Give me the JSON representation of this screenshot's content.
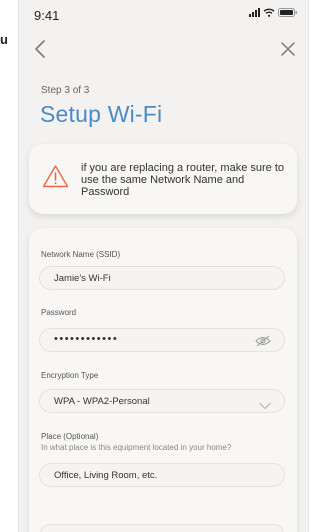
{
  "status_bar": {
    "time": "9:41"
  },
  "nav": {
    "back_icon": "chevron-left-icon",
    "close_icon": "close-icon"
  },
  "header": {
    "step": "Step 3 of 3",
    "title": "Setup Wi-Fi"
  },
  "banner": {
    "icon": "warning-icon",
    "text": "if you are replacing a router, make sure to use the same Network Name and Password"
  },
  "form": {
    "network_name": {
      "label": "Network Name (SSID)",
      "value": "Jamie's Wi-Fi"
    },
    "password": {
      "label": "Password",
      "value": "••••••••••••",
      "toggle_icon": "eye-hidden-icon"
    },
    "encryption": {
      "label": "Encryption Type",
      "value": "WPA - WPA2-Personal"
    },
    "place": {
      "label": "Place (Optional)",
      "hint": "In what place is this equipment located in your home?",
      "placeholder": "Office, Living Room, etc."
    }
  },
  "colors": {
    "accent": "#4a8bc6",
    "warning": "#e8674a"
  }
}
